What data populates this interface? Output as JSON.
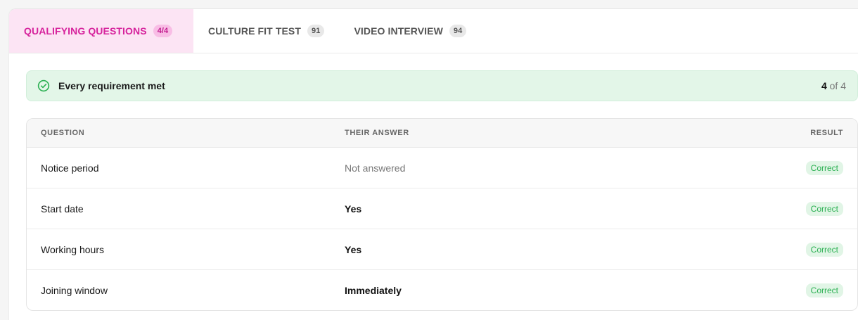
{
  "tabs": [
    {
      "label": "QUALIFYING QUESTIONS",
      "count": "4/4",
      "active": true
    },
    {
      "label": "CULTURE FIT TEST",
      "count": "91",
      "active": false
    },
    {
      "label": "VIDEO INTERVIEW",
      "count": "94",
      "active": false
    }
  ],
  "summary": {
    "icon": "check-circle-icon",
    "message": "Every requirement met",
    "met": "4",
    "of_label": "of 4"
  },
  "table": {
    "headers": {
      "question": "QUESTION",
      "answer": "THEIR ANSWER",
      "result": "RESULT"
    },
    "rows": [
      {
        "question": "Notice period",
        "answer": "Not answered",
        "answered": false,
        "result": "Correct"
      },
      {
        "question": "Start date",
        "answer": "Yes",
        "answered": true,
        "result": "Correct"
      },
      {
        "question": "Working hours",
        "answer": "Yes",
        "answered": true,
        "result": "Correct"
      },
      {
        "question": "Joining window",
        "answer": "Immediately",
        "answered": true,
        "result": "Correct"
      }
    ]
  },
  "colors": {
    "accent": "#d6229c",
    "success": "#2bb052",
    "success_bg": "#e3f6e8"
  }
}
